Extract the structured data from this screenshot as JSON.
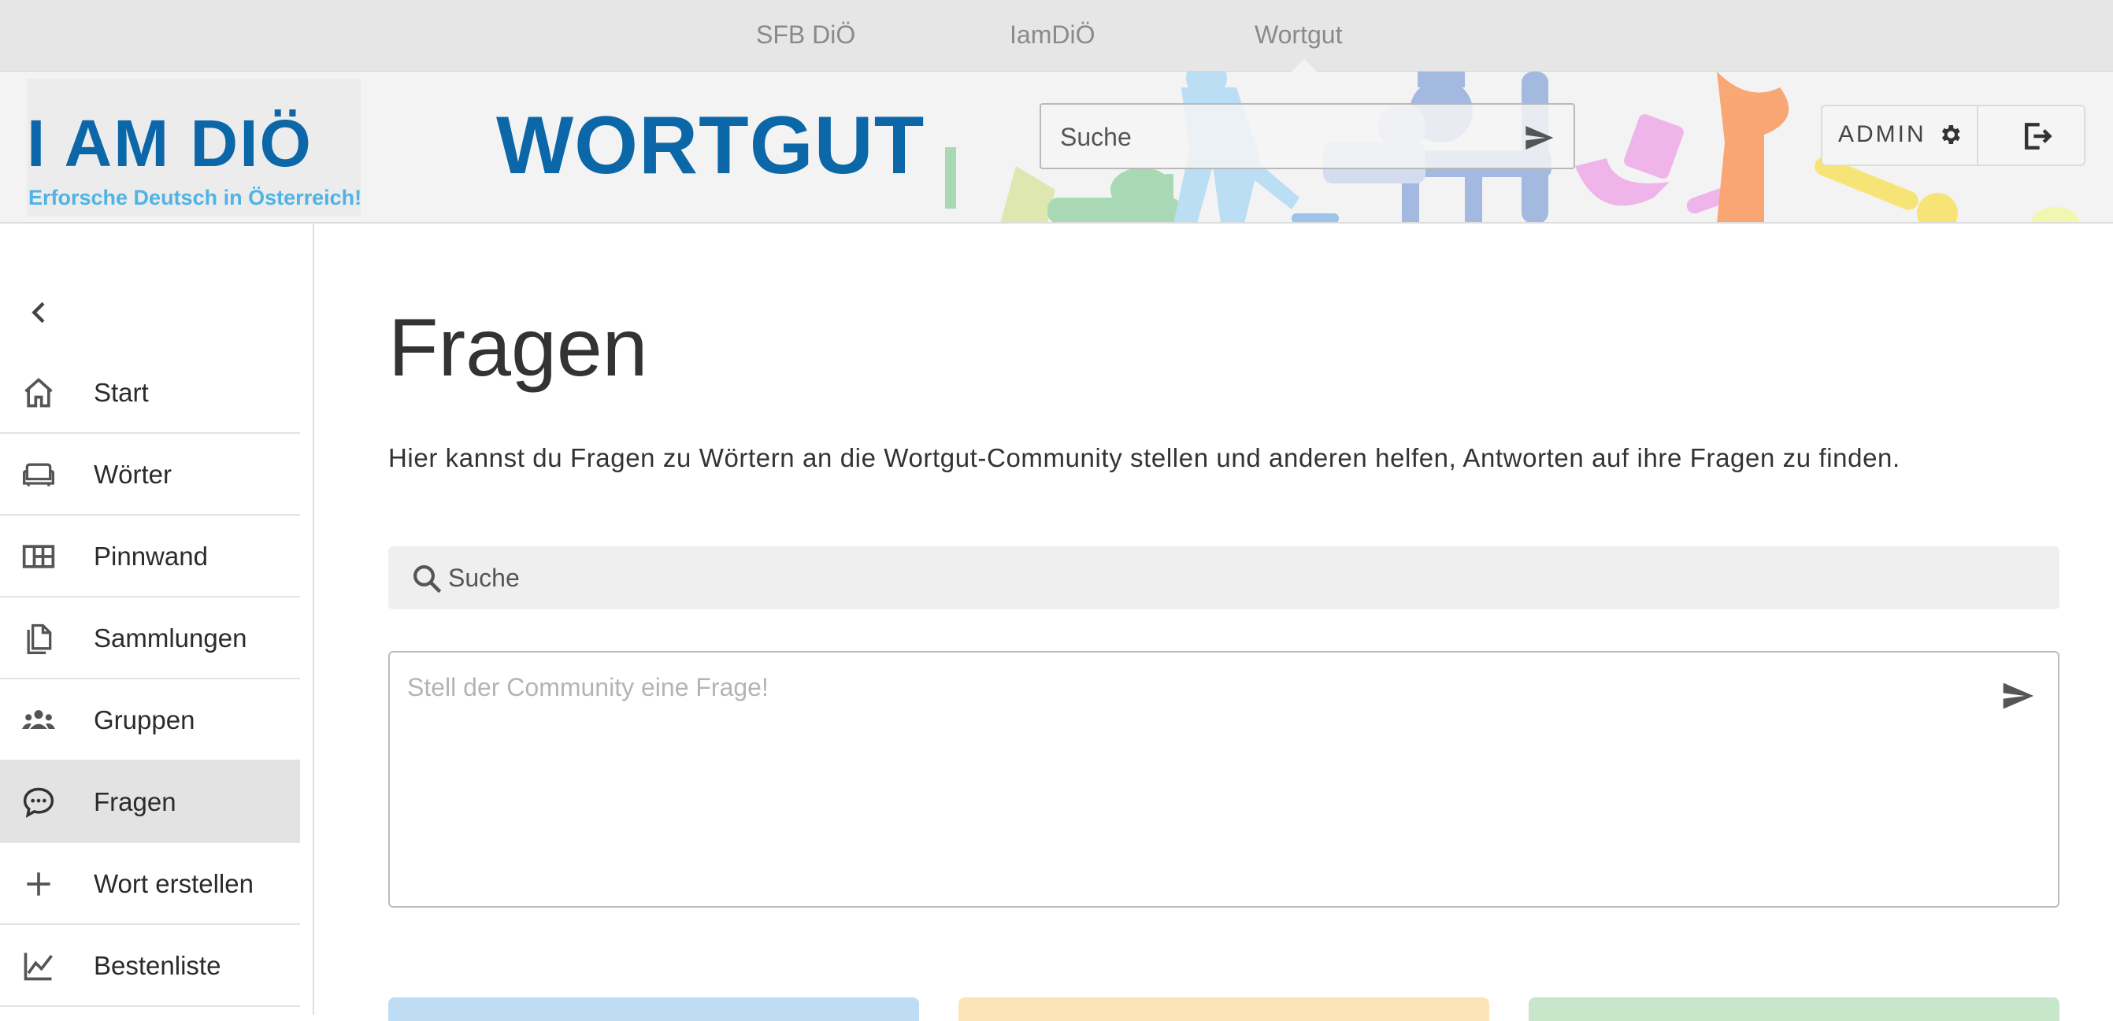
{
  "top_nav": {
    "items": [
      {
        "label": "SFB DiÖ"
      },
      {
        "label": "IamDiÖ"
      },
      {
        "label": "Wortgut"
      }
    ]
  },
  "header": {
    "logo_main": "I AM DIÖ",
    "logo_sub": "Erforsche Deutsch in Österreich!",
    "app_title": "WORTGUT",
    "search_placeholder": "Suche",
    "user_label": "ADMIN"
  },
  "sidebar": {
    "items": [
      {
        "label": "Start",
        "icon": "home-icon"
      },
      {
        "label": "Wörter",
        "icon": "sofa-icon"
      },
      {
        "label": "Pinnwand",
        "icon": "board-icon"
      },
      {
        "label": "Sammlungen",
        "icon": "documents-icon"
      },
      {
        "label": "Gruppen",
        "icon": "groups-icon"
      },
      {
        "label": "Fragen",
        "icon": "chat-bubble-icon",
        "active": true
      },
      {
        "label": "Wort erstellen",
        "icon": "plus-icon"
      },
      {
        "label": "Bestenliste",
        "icon": "chart-line-icon"
      }
    ]
  },
  "main": {
    "title": "Fragen",
    "description": "Hier kannst du Fragen zu Wörtern an die Wortgut-Community stellen und anderen helfen, Antworten auf ihre Fragen zu finden.",
    "search_placeholder": "Suche",
    "question_placeholder": "Stell der Community eine Frage!"
  },
  "colors": {
    "brand_blue": "#0b67a8",
    "logo_sub_blue": "#4fb3e6",
    "tile_blue": "#bfdcf5",
    "tile_orange": "#fde3b8",
    "tile_green": "#c8e6c9"
  }
}
